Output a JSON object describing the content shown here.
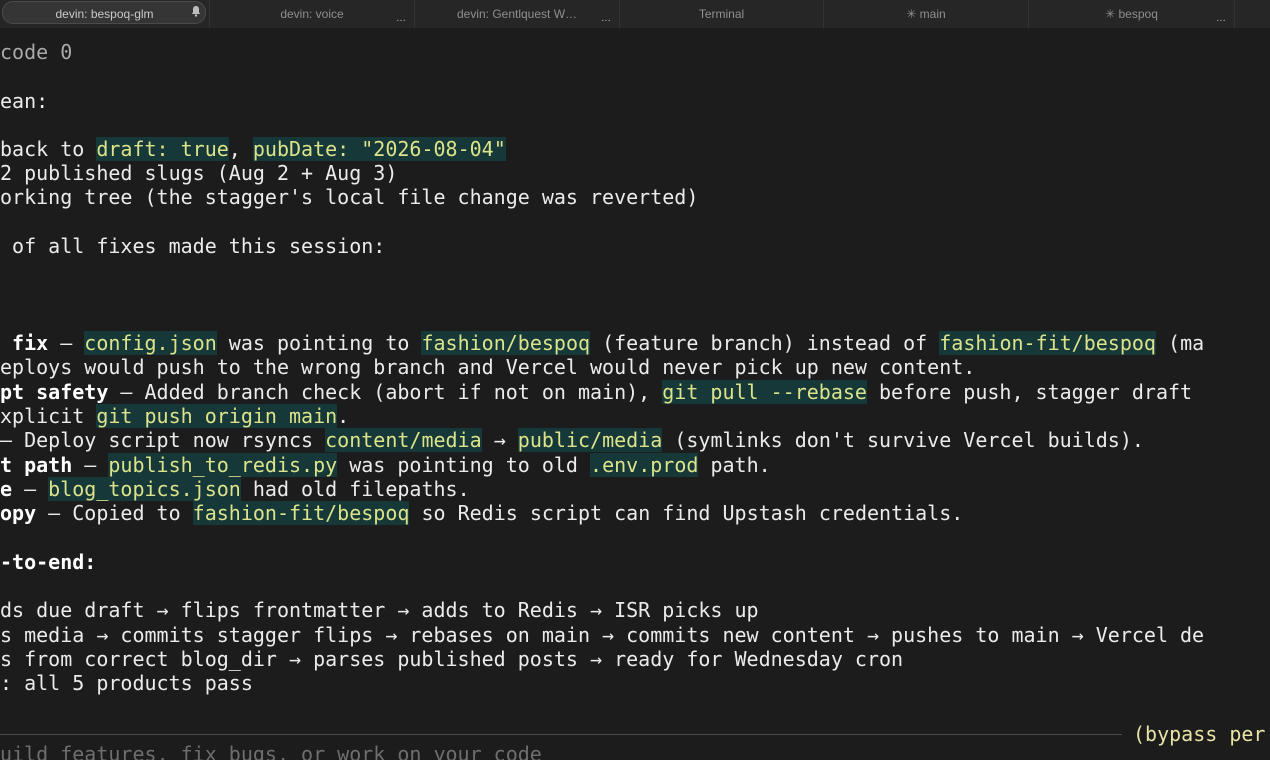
{
  "tabs": [
    {
      "label": "devin: bespoq-glm",
      "active": true,
      "icon": "bell-icon"
    },
    {
      "label": "devin: voice",
      "menu": "…"
    },
    {
      "label": "devin: Gentlquest W…",
      "menu": "…"
    },
    {
      "label": "Terminal"
    },
    {
      "label": "✳ main"
    },
    {
      "label": "✳ bespoq",
      "menu": "…"
    }
  ],
  "terminal": {
    "l01": "code 0",
    "l02": "ean:",
    "l03a": "back to ",
    "l03b": "draft: true",
    "l03c": ", ",
    "l03d": "pubDate: \"2026-08-04\"",
    "l04": "2 published slugs (Aug 2 + Aug 3)",
    "l05": "orking tree (the stagger's local file change was reverted)",
    "l06": " of all fixes made this session:",
    "l07a": " fix",
    "l07b": " — ",
    "l07c": "config.json",
    "l07d": " was pointing to ",
    "l07e": "fashion/bespoq",
    "l07f": " (feature branch) instead of ",
    "l07g": "fashion-fit/bespoq",
    "l07h": " (ma",
    "l08": "eploys would push to the wrong branch and Vercel would never pick up new content.",
    "l09a": "pt safety",
    "l09b": " — Added branch check (abort if not on main), ",
    "l09c": "git pull --rebase",
    "l09d": " before push, stagger draft",
    "l10a": "xplicit ",
    "l10b": "git push origin main",
    "l10c": ".",
    "l11a": "— Deploy script now rsyncs ",
    "l11b": "content/media",
    "l11c": " → ",
    "l11d": "public/media",
    "l11e": " (symlinks don't survive Vercel builds).",
    "l12a": "t path",
    "l12b": " — ",
    "l12c": "publish_to_redis.py",
    "l12d": " was pointing to old ",
    "l12e": ".env.prod",
    "l12f": " path.",
    "l13a": "e",
    "l13b": " — ",
    "l13c": "blog_topics.json",
    "l13d": " had old filepaths.",
    "l14a": "opy",
    "l14b": " — Copied to ",
    "l14c": "fashion-fit/bespoq",
    "l14d": " so Redis script can find Upstash credentials.",
    "l15": "-to-end:",
    "l16": "ds due draft → flips frontmatter → adds to Redis → ISR picks up",
    "l17": "s media → commits stagger flips → rebases on main → commits new content → pushes to main → Vercel de",
    "l18": "s from correct blog_dir → parses published posts → ready for Wednesday cron",
    "l19": ": all 5 products pass"
  },
  "status": {
    "bypass": "(bypass per"
  },
  "prompt": {
    "placeholder": "uild features, fix bugs, or work on your code"
  },
  "colors": {
    "background": "#1c1c1c",
    "highlight_text": "#dce38a",
    "highlight_bg": "#163838",
    "bypass_text": "#e7e3a6"
  }
}
